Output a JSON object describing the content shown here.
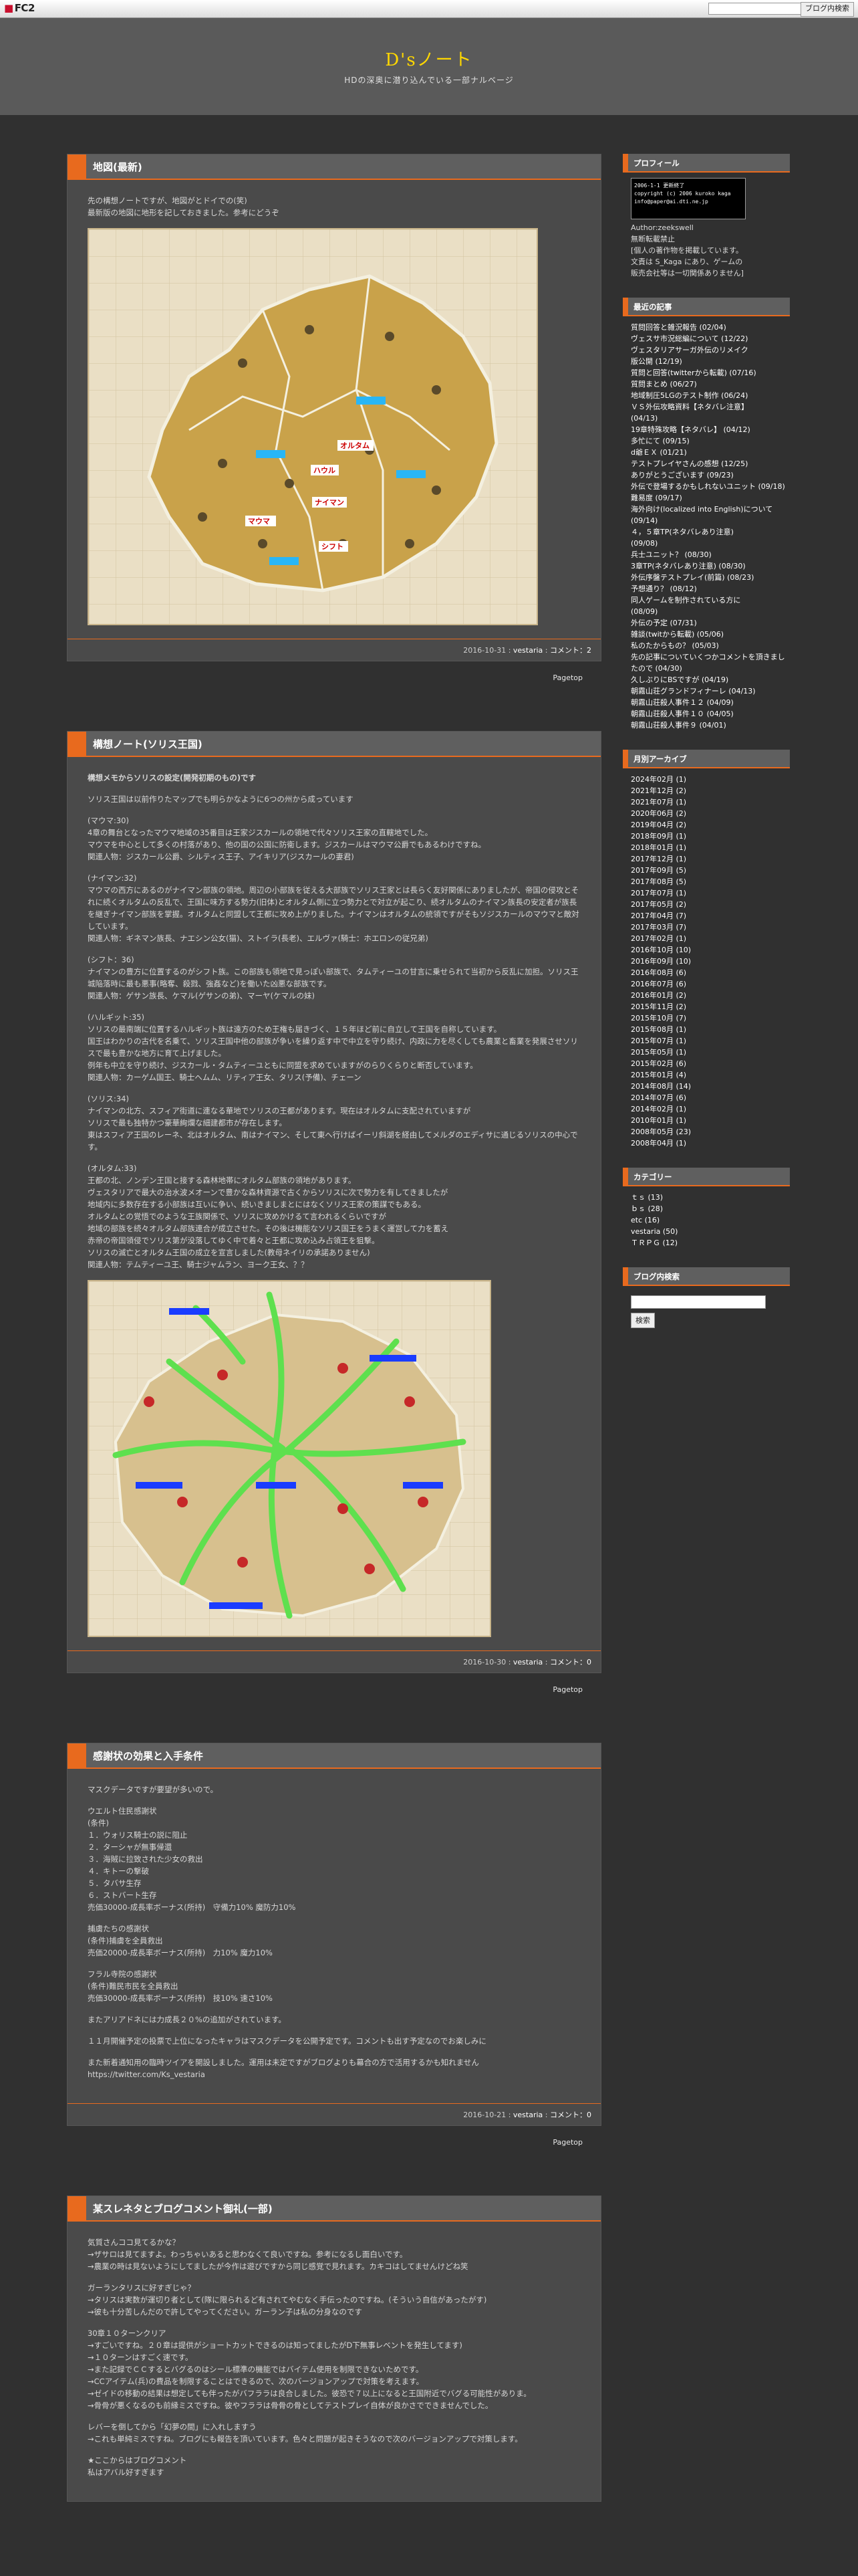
{
  "topbar": {
    "logo": "FC2",
    "search_button": "ブログ内検索"
  },
  "header": {
    "title": "D'sノート",
    "description": "HDの深奥に潜り込んでいる一部ナルベージ"
  },
  "entries": [
    {
      "title": "地図(最新)",
      "paragraphs": [
        "先の構想ノートですが、地図がとドイでの(笑)\n最新版の地図に地形を記しておきました。参考にどうぞ"
      ],
      "map_labels": [
        "オルタム",
        "ハウル",
        "ナイマン",
        "マウマ",
        "シフト"
      ],
      "date": "2016-10-31",
      "author": "vestaria",
      "comment_label": "コメント：2",
      "pagetop": "Pagetop"
    },
    {
      "title": "構想ノート(ソリス王国)",
      "paragraphs": [
        "構想メモからソリスの設定(開発初期のもの)です",
        "ソリス王国は以前作りたマップでも明らかなように6つの州から成っています",
        "(マウマ:30)\n4章の舞台となったマウマ地域の35番目は王家ジスカールの領地で代々ソリス王家の直轄地でした。\nマウマを中心として多くの村落があり、他の国の公国に防衛します。ジスカールはマウマ公爵でもあるわけですね。\n関連人物：ジスカール公爵、シルティス王子、アイキリア(ジスカールの妻君)",
        "(ナイマン:32)\nマウマの西方にあるのがナイマン部族の領地。周辺の小部族を従える大部族でソリス王家とは長らく友好関係にありましたが、帝国の侵攻とそれに続くオルタムの反乱で、王国に味方する勢力(旧体)とオルタム側に立つ勢力とで対立が起こり、続オルタムのナイマン族長の安定者が族長を継ぎナイマン部族を掌握。オルタムと同盟して王都に攻め上がりました。ナイマンはオルタムの統領ですがそもソジスカールのマウマと敵対しています。\n関連人物：ギネマン族長、ナエシン公女(猫)、ストイラ(長老)、エルヴァ(騎士：ホエロンの従兄弟)",
        "(シフト：36)\nナイマンの豊方に位置するのがシフト族。この部族も領地で見っぽい部族で、タムティーユの甘言に乗せられて当初から反乱に加担。ソリス王城陥落時に最も悪事(略奪、殺戮、強姦など)を働いた凶悪な部族です。\n関連人物：ゲサン族長、ケマル(ゲサンの弟)、マーヤ(ケマルの妹)",
        "(ハルギット:35)\nソリスの最南端に位置するハルギット族は遠方のため王権も届きづく、１５年ほど前に自立して王国を自称しています。\n国王はわかりの古代を名乗て、ソリス王国中他の部族が争いを繰り返す中で中立を守り続け、内政に力を尽くしても農業と畜業を発展させソリスで最も豊かな地方に育て上げました。\n例年も中立を守り続け、ジスカール・タムティーユともに同盟を求めていますがのらりくらりと断否しています。\n関連人物：カーゲム国王、騎士ヘムム、リティア王女、タリス(予備)、チェーン",
        "(ソリス:34)\nナイマンの北方、スフィア街道に連なる華地でソリスの王都があります。現在はオルタムに支配されていますが\nソリスで最も独特かつ豪華絢爛な細建都市が存在します。\n東はスフィア王国のレーネ、北はオルタム、南はナイマン、そして東へ行けばイーリ斜湖を経由してメルダのエディサに通じるソリスの中心です。",
        "(オルタム:33)\n王都の北、ノンデン王国と接する森林地帯にオルタム部族の領地があります。\nヴェスタリアで最大の治水波メオーンで豊かな森林資源で古くからソリスに次で勢力を有してきましたが\n地域内に多数存在する小部族は互いに争い、続いきましまとにはなくソリス王家の策謀でもある。\nオルタムとの覚悟でのような王族関係で、ソリスに攻めかけるて言われるくらいですが\n地域の部族を続々オルタム部族連合が成立させた。その後は機能なソリス国王をうまく運営して力を蓄え\n赤帝の帝国領侵でソリス第が没落してゆく中で着々と王都に攻め込み占領王を狙撃。\nソリスの滅亡とオルタム王国の成立を宣言しました(教母ネイリの承諾ありません)\n関連人物：テムティーユ王、騎士ジャムラン、ヨーク王女、？？"
      ],
      "date": "2016-10-30",
      "author": "vestaria",
      "comment_label": "コメント：0",
      "pagetop": "Pagetop"
    },
    {
      "title": "感謝状の効果と入手条件",
      "paragraphs": [
        "マスクデータですが要望が多いので。",
        "ウエルト住民感謝状\n(条件)\n１．ウォリス騎士の説に阻止\n２．ターシャが無事帰還\n３．海賊に拉致された少女の救出\n４．キトーの撃破\n５．タバサ生存\n６．ストバート生存\n売価30000-成長率ボーナス(所持)　守備力10% 魔防力10%",
        "捕虜たちの感謝状\n(条件)捕虜を全員救出\n売価20000-成長率ボーナス(所持)　力10% 魔力10%",
        "フラル寺院の感謝状\n(条件)難民市民を全員救出\n売価30000-成長率ボーナス(所持)　技10% 速さ10%",
        "またアリアドネには力成長２０%の追加がされています。",
        "１１月開催予定の投票で上位になったキャラはマスクデータを公開予定です。コメントも出す予定なのでお楽しみに",
        "また新着通知用の臨時ツイアを開設しました。運用は未定ですがブログよりも幕合の方で活用するかも知れません\nhttps://twitter.com/Ks_vestaria"
      ],
      "date": "2016-10-21",
      "author": "vestaria",
      "comment_label": "コメント：0",
      "pagetop": "Pagetop"
    },
    {
      "title": "某スレネタとブログコメント御礼(一部)",
      "paragraphs": [
        "気質さんココ見てるかな？\n→ザサロは見てますよ。わっちゃいあると思わなくて良いですね。参考になるし面白いです。\n→農業の時は見ないようにしてましたが今作は遊びですから同じ感覚で見れます。カキコはしてませんけどね笑",
        "ガーランタリスに好すぎじゃ？\n→タリスは実数が運切り者として(隊に限られるど有されてやむなく手伝ったのですね。(そういう自信があったがす)\n→彼も十分苦しんだので許してやってください。ガーラン子は私の分身なのです",
        "30章１０ターンクリア\n→すごいですね。２０章は提供がショートカットできるのは知ってましたがD下無事レベントを発生してます)\n→１０ターンはすごく速です。\n→また記録でＣＣするとバグるのはシール標準の機能ではバイテム使用を制限できないためです。\n→CCアイテム(兵)の費品を制限することはできるので、次のバージョンアップで対策を考えます。\n→ゼイドの移動の結果は想定しても伴ったがバフララは良合しました。彼恐で７以上になると王国附近でバグる可能性がありま。\n→骨骨が悪くなるのも前縁ミスですね。彼やフララは骨骨の骨としてテストプレイ自体が良かさでできませんでした。",
        "レバーを倒してから「幻夢の間」に入れしますう\n→これも単純ミスですね。ブログにも報告を頂いています。色々と問題が起きそうなので次のバージョンアップで対策します。",
        "★ここからはブログコメント\n私はアバル好すぎます"
      ],
      "date": "",
      "author": "",
      "comment_label": "",
      "pagetop": ""
    }
  ],
  "sidebar": {
    "profile": {
      "title": "プロフィール",
      "badge_lines": [
        "2006-1-1 更新終了",
        "copyright (c) 2006 kuroko kaga",
        "info@paper@ai.dti.ne.jp"
      ],
      "author_label": "Author:zeekswell",
      "lines": [
        "無断転載禁止",
        "[個人の著作物を掲載しています。",
        "文責は S_Kaga にあり、ゲームの",
        "販売会社等は一切関係ありません]"
      ]
    },
    "recent": {
      "title": "最近の記事",
      "items": [
        "質問回答と雑況報告 (02/04)",
        "ヴェスサ市況総編について (12/22)",
        "ヴェスタリアサーガ外伝のリメイク",
        "版公開 (12/19)",
        "質問と回答(twitterから転載) (07/16)",
        "質問まとめ (06/27)",
        "地域制圧5LGのテスト制作 (06/24)",
        "ＶＳ外伝攻略資料【ネタバレ注意】",
        "(04/13)",
        "19章特殊攻略【ネタバレ】 (04/12)",
        "多忙にて (09/15)",
        "d爺ＥＸ (01/21)",
        "テストプレイヤさんの感想 (12/25)",
        "ありがとうございます (09/23)",
        "外伝で登場するかもしれないユニット (09/18)",
        "難易度 (09/17)",
        "海外向け(localized into English)について (09/14)",
        "４，５章TP(ネタバレあり注意)",
        "(09/08)",
        "兵士ユニット？ (08/30)",
        "3章TP(ネタバレあり注意) (08/30)",
        "外伝序盤テストプレイ(前篇) (08/23)",
        "予想通り？ (08/12)",
        "同人ゲームを制作されている方に",
        "(08/09)",
        "外伝の予定 (07/31)",
        "雑談(twitから転載) (05/06)",
        "私のたからもの？ (05/03)",
        "先の記事についていくつかコメントを頂きましたので (04/30)",
        "久しぶりにBSですが (04/19)",
        "朝霧山荘グランドフィナーレ (04/13)",
        "朝霧山荘殺人事件１２ (04/09)",
        "朝霧山荘殺人事件１０ (04/05)",
        "朝霧山荘殺人事件９ (04/01)"
      ]
    },
    "archives": {
      "title": "月別アーカイブ",
      "items": [
        "2024年02月 (1)",
        "2021年12月 (2)",
        "2021年07月 (1)",
        "2020年06月 (2)",
        "2019年04月 (2)",
        "2018年09月 (1)",
        "2018年01月 (1)",
        "2017年12月 (1)",
        "2017年09月 (5)",
        "2017年08月 (5)",
        "2017年07月 (1)",
        "2017年05月 (2)",
        "2017年04月 (7)",
        "2017年03月 (7)",
        "2017年02月 (1)",
        "2016年10月 (10)",
        "2016年09月 (10)",
        "2016年08月 (6)",
        "2016年07月 (6)",
        "2016年01月 (2)",
        "2015年11月 (2)",
        "2015年10月 (7)",
        "2015年08月 (1)",
        "2015年07月 (1)",
        "2015年05月 (1)",
        "2015年02月 (6)",
        "2015年01月 (4)",
        "2014年08月 (14)",
        "2014年07月 (6)",
        "2014年02月 (1)",
        "2010年01月 (1)",
        "2008年05月 (23)",
        "2008年04月 (1)"
      ]
    },
    "categories": {
      "title": "カテゴリー",
      "items": [
        "ｔｓ (13)",
        "ｂｓ (28)",
        "etc (16)",
        "vestaria (50)",
        "ＴＲＰＧ (12)"
      ]
    },
    "search": {
      "title": "ブログ内検索",
      "button": "検索"
    }
  },
  "colors": {
    "accent": "#e86a1e",
    "title": "#ffd700",
    "background": "#303030"
  }
}
